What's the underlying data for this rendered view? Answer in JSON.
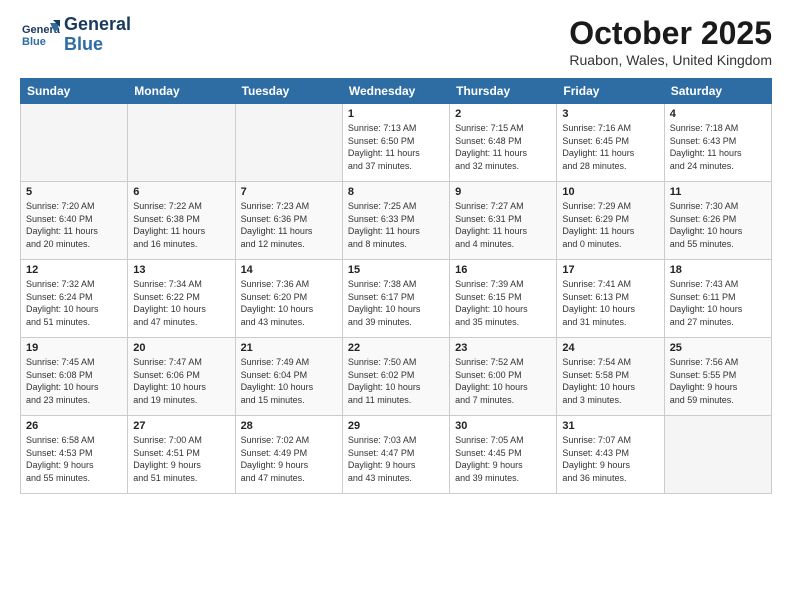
{
  "header": {
    "logo_line1": "General",
    "logo_line2": "Blue",
    "month": "October 2025",
    "location": "Ruabon, Wales, United Kingdom"
  },
  "weekdays": [
    "Sunday",
    "Monday",
    "Tuesday",
    "Wednesday",
    "Thursday",
    "Friday",
    "Saturday"
  ],
  "weeks": [
    [
      {
        "day": "",
        "info": ""
      },
      {
        "day": "",
        "info": ""
      },
      {
        "day": "",
        "info": ""
      },
      {
        "day": "1",
        "info": "Sunrise: 7:13 AM\nSunset: 6:50 PM\nDaylight: 11 hours\nand 37 minutes."
      },
      {
        "day": "2",
        "info": "Sunrise: 7:15 AM\nSunset: 6:48 PM\nDaylight: 11 hours\nand 32 minutes."
      },
      {
        "day": "3",
        "info": "Sunrise: 7:16 AM\nSunset: 6:45 PM\nDaylight: 11 hours\nand 28 minutes."
      },
      {
        "day": "4",
        "info": "Sunrise: 7:18 AM\nSunset: 6:43 PM\nDaylight: 11 hours\nand 24 minutes."
      }
    ],
    [
      {
        "day": "5",
        "info": "Sunrise: 7:20 AM\nSunset: 6:40 PM\nDaylight: 11 hours\nand 20 minutes."
      },
      {
        "day": "6",
        "info": "Sunrise: 7:22 AM\nSunset: 6:38 PM\nDaylight: 11 hours\nand 16 minutes."
      },
      {
        "day": "7",
        "info": "Sunrise: 7:23 AM\nSunset: 6:36 PM\nDaylight: 11 hours\nand 12 minutes."
      },
      {
        "day": "8",
        "info": "Sunrise: 7:25 AM\nSunset: 6:33 PM\nDaylight: 11 hours\nand 8 minutes."
      },
      {
        "day": "9",
        "info": "Sunrise: 7:27 AM\nSunset: 6:31 PM\nDaylight: 11 hours\nand 4 minutes."
      },
      {
        "day": "10",
        "info": "Sunrise: 7:29 AM\nSunset: 6:29 PM\nDaylight: 11 hours\nand 0 minutes."
      },
      {
        "day": "11",
        "info": "Sunrise: 7:30 AM\nSunset: 6:26 PM\nDaylight: 10 hours\nand 55 minutes."
      }
    ],
    [
      {
        "day": "12",
        "info": "Sunrise: 7:32 AM\nSunset: 6:24 PM\nDaylight: 10 hours\nand 51 minutes."
      },
      {
        "day": "13",
        "info": "Sunrise: 7:34 AM\nSunset: 6:22 PM\nDaylight: 10 hours\nand 47 minutes."
      },
      {
        "day": "14",
        "info": "Sunrise: 7:36 AM\nSunset: 6:20 PM\nDaylight: 10 hours\nand 43 minutes."
      },
      {
        "day": "15",
        "info": "Sunrise: 7:38 AM\nSunset: 6:17 PM\nDaylight: 10 hours\nand 39 minutes."
      },
      {
        "day": "16",
        "info": "Sunrise: 7:39 AM\nSunset: 6:15 PM\nDaylight: 10 hours\nand 35 minutes."
      },
      {
        "day": "17",
        "info": "Sunrise: 7:41 AM\nSunset: 6:13 PM\nDaylight: 10 hours\nand 31 minutes."
      },
      {
        "day": "18",
        "info": "Sunrise: 7:43 AM\nSunset: 6:11 PM\nDaylight: 10 hours\nand 27 minutes."
      }
    ],
    [
      {
        "day": "19",
        "info": "Sunrise: 7:45 AM\nSunset: 6:08 PM\nDaylight: 10 hours\nand 23 minutes."
      },
      {
        "day": "20",
        "info": "Sunrise: 7:47 AM\nSunset: 6:06 PM\nDaylight: 10 hours\nand 19 minutes."
      },
      {
        "day": "21",
        "info": "Sunrise: 7:49 AM\nSunset: 6:04 PM\nDaylight: 10 hours\nand 15 minutes."
      },
      {
        "day": "22",
        "info": "Sunrise: 7:50 AM\nSunset: 6:02 PM\nDaylight: 10 hours\nand 11 minutes."
      },
      {
        "day": "23",
        "info": "Sunrise: 7:52 AM\nSunset: 6:00 PM\nDaylight: 10 hours\nand 7 minutes."
      },
      {
        "day": "24",
        "info": "Sunrise: 7:54 AM\nSunset: 5:58 PM\nDaylight: 10 hours\nand 3 minutes."
      },
      {
        "day": "25",
        "info": "Sunrise: 7:56 AM\nSunset: 5:55 PM\nDaylight: 9 hours\nand 59 minutes."
      }
    ],
    [
      {
        "day": "26",
        "info": "Sunrise: 6:58 AM\nSunset: 4:53 PM\nDaylight: 9 hours\nand 55 minutes."
      },
      {
        "day": "27",
        "info": "Sunrise: 7:00 AM\nSunset: 4:51 PM\nDaylight: 9 hours\nand 51 minutes."
      },
      {
        "day": "28",
        "info": "Sunrise: 7:02 AM\nSunset: 4:49 PM\nDaylight: 9 hours\nand 47 minutes."
      },
      {
        "day": "29",
        "info": "Sunrise: 7:03 AM\nSunset: 4:47 PM\nDaylight: 9 hours\nand 43 minutes."
      },
      {
        "day": "30",
        "info": "Sunrise: 7:05 AM\nSunset: 4:45 PM\nDaylight: 9 hours\nand 39 minutes."
      },
      {
        "day": "31",
        "info": "Sunrise: 7:07 AM\nSunset: 4:43 PM\nDaylight: 9 hours\nand 36 minutes."
      },
      {
        "day": "",
        "info": ""
      }
    ]
  ]
}
